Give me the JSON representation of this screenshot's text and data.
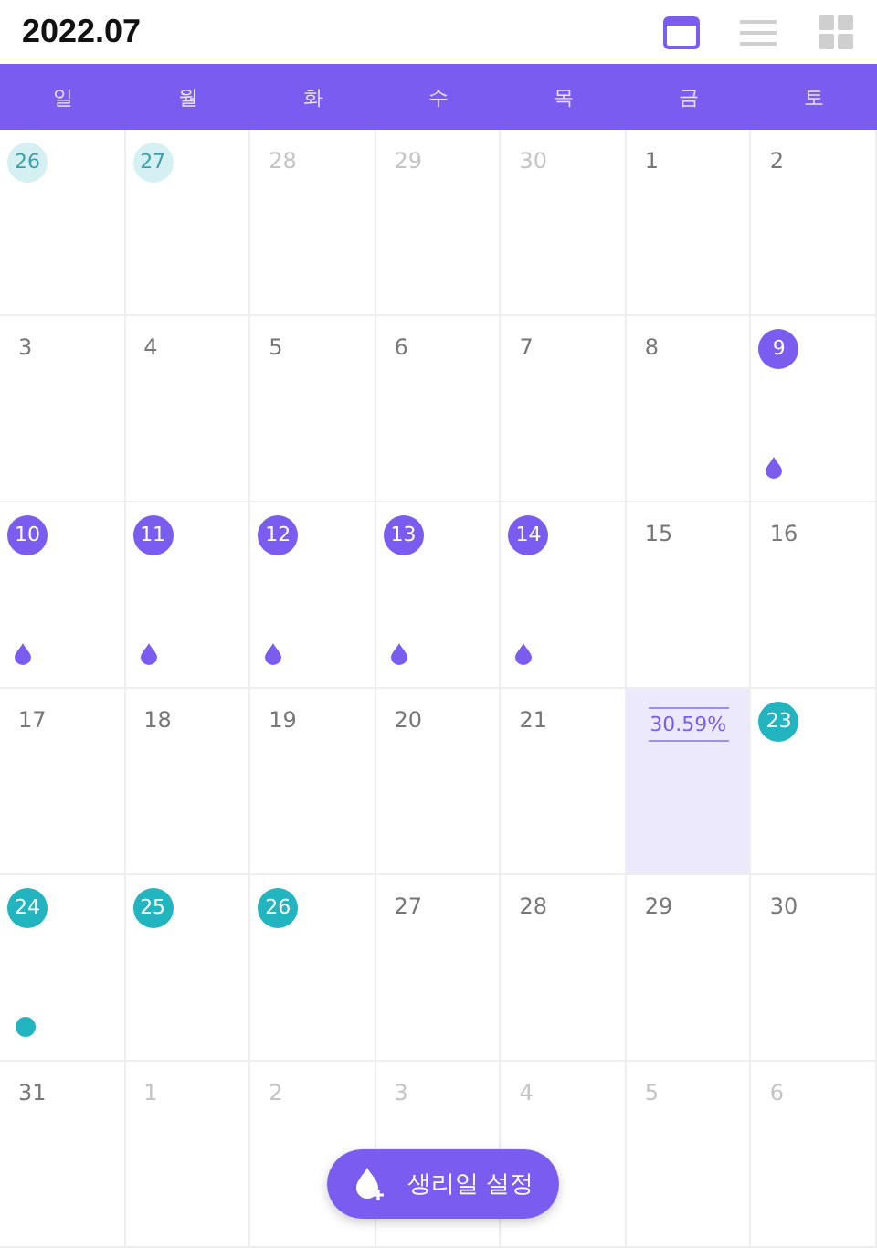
{
  "header": {
    "title": "2022.07",
    "views": [
      {
        "kind": "calendar",
        "selected": true
      },
      {
        "kind": "list",
        "selected": false
      },
      {
        "kind": "grid",
        "selected": false
      }
    ]
  },
  "weekdays": [
    "일",
    "월",
    "화",
    "수",
    "목",
    "금",
    "토"
  ],
  "days": [
    {
      "label": "26",
      "kind": "fertile",
      "in_month": false,
      "selected": false
    },
    {
      "label": "27",
      "kind": "fertile",
      "in_month": false,
      "selected": false
    },
    {
      "label": "28",
      "kind": "plain",
      "in_month": false,
      "selected": false
    },
    {
      "label": "29",
      "kind": "plain",
      "in_month": false,
      "selected": false
    },
    {
      "label": "30",
      "kind": "plain",
      "in_month": false,
      "selected": false
    },
    {
      "label": "1",
      "kind": "plain",
      "in_month": true,
      "selected": false
    },
    {
      "label": "2",
      "kind": "plain",
      "in_month": true,
      "selected": false
    },
    {
      "label": "3",
      "kind": "plain",
      "in_month": true,
      "selected": false
    },
    {
      "label": "4",
      "kind": "plain",
      "in_month": true,
      "selected": false
    },
    {
      "label": "5",
      "kind": "plain",
      "in_month": true,
      "selected": false
    },
    {
      "label": "6",
      "kind": "plain",
      "in_month": true,
      "selected": false
    },
    {
      "label": "7",
      "kind": "plain",
      "in_month": true,
      "selected": false
    },
    {
      "label": "8",
      "kind": "plain",
      "in_month": true,
      "selected": false
    },
    {
      "label": "9",
      "kind": "period",
      "in_month": true,
      "selected": false
    },
    {
      "label": "10",
      "kind": "period",
      "in_month": true,
      "selected": false
    },
    {
      "label": "11",
      "kind": "period",
      "in_month": true,
      "selected": false
    },
    {
      "label": "12",
      "kind": "period",
      "in_month": true,
      "selected": false
    },
    {
      "label": "13",
      "kind": "period",
      "in_month": true,
      "selected": false
    },
    {
      "label": "14",
      "kind": "period",
      "in_month": true,
      "selected": false
    },
    {
      "label": "15",
      "kind": "plain",
      "in_month": true,
      "selected": false
    },
    {
      "label": "16",
      "kind": "plain",
      "in_month": true,
      "selected": false
    },
    {
      "label": "17",
      "kind": "plain",
      "in_month": true,
      "selected": false
    },
    {
      "label": "18",
      "kind": "plain",
      "in_month": true,
      "selected": false
    },
    {
      "label": "19",
      "kind": "plain",
      "in_month": true,
      "selected": false
    },
    {
      "label": "20",
      "kind": "plain",
      "in_month": true,
      "selected": false
    },
    {
      "label": "21",
      "kind": "plain",
      "in_month": true,
      "selected": false
    },
    {
      "label": "30.59%",
      "kind": "percent",
      "selected": true
    },
    {
      "label": "23",
      "kind": "fertile",
      "in_month": true,
      "selected": false
    },
    {
      "label": "24",
      "kind": "ovulation",
      "in_month": true,
      "selected": false
    },
    {
      "label": "25",
      "kind": "fertile",
      "in_month": true,
      "selected": false
    },
    {
      "label": "26",
      "kind": "fertile",
      "in_month": true,
      "selected": false
    },
    {
      "label": "27",
      "kind": "plain",
      "in_month": true,
      "selected": false
    },
    {
      "label": "28",
      "kind": "plain",
      "in_month": true,
      "selected": false
    },
    {
      "label": "29",
      "kind": "plain",
      "in_month": true,
      "selected": false
    },
    {
      "label": "30",
      "kind": "plain",
      "in_month": true,
      "selected": false
    },
    {
      "label": "31",
      "kind": "plain",
      "in_month": true,
      "selected": false
    },
    {
      "label": "1",
      "kind": "plain",
      "in_month": false,
      "selected": false
    },
    {
      "label": "2",
      "kind": "plain",
      "in_month": false,
      "selected": false
    },
    {
      "label": "3",
      "kind": "plain",
      "in_month": false,
      "selected": false
    },
    {
      "label": "4",
      "kind": "plain",
      "in_month": false,
      "selected": false
    },
    {
      "label": "5",
      "kind": "plain",
      "in_month": false,
      "selected": false
    },
    {
      "label": "6",
      "kind": "plain",
      "in_month": false,
      "selected": false
    }
  ],
  "action_button": {
    "label": "생리일 설정"
  }
}
